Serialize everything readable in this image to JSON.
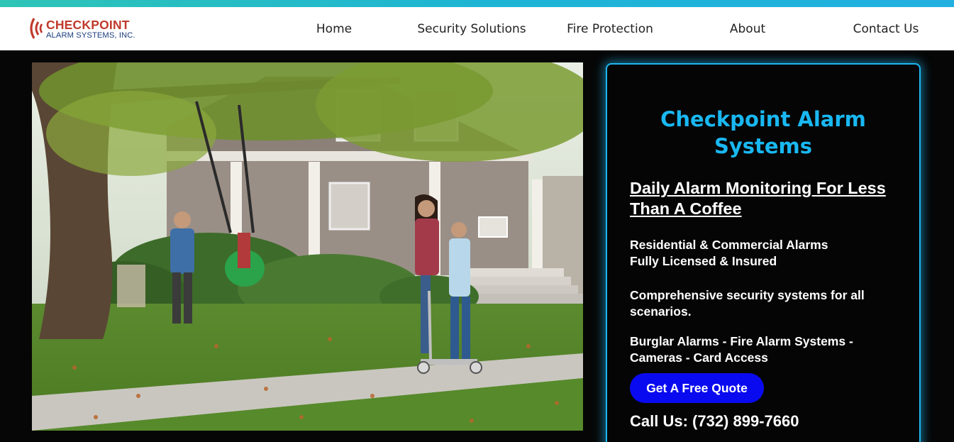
{
  "brand": {
    "name": "CHECKPOINT",
    "subtitle": "ALARM SYSTEMS, INC.",
    "primary_color": "#c0392b",
    "secondary_color": "#1a3d7c"
  },
  "nav": {
    "items": [
      {
        "label": "Home"
      },
      {
        "label": "Security Solutions"
      },
      {
        "label": "Fire Protection"
      },
      {
        "label": "About"
      },
      {
        "label": "Contact Us"
      }
    ]
  },
  "hero": {
    "image_icon": "family-yard-photo"
  },
  "panel": {
    "title": "Checkpoint Alarm Systems",
    "headline": "Daily Alarm Monitoring For Less Than A Coffee",
    "line1": "Residential & Commercial Alarms",
    "line2": "Fully Licensed & Insured",
    "line3": "Comprehensive security systems for all scenarios.",
    "line4": "Burglar Alarms - Fire Alarm Systems - Cameras - Card Access",
    "cta_label": "Get A Free Quote",
    "phone": "Call Us: (732) 899-7660",
    "accent_color": "#19b8f2",
    "button_color": "#0a0af0"
  }
}
